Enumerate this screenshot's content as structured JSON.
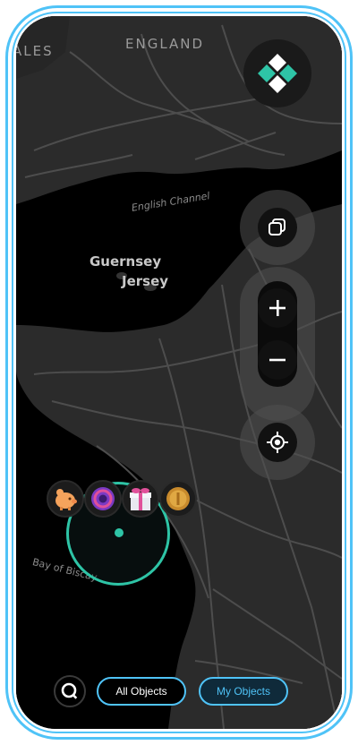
{
  "map": {
    "labels": {
      "wales": "ALES",
      "england": "ENGLAND",
      "channel": "English Channel",
      "guernsey": "Guernsey",
      "jersey": "Jersey",
      "biscay": "Bay of Biscay"
    }
  },
  "controls": {
    "zoom_in_symbol": "+",
    "zoom_out_symbol": "−",
    "icons": [
      "app-logo-icon",
      "layers-icon",
      "plus-icon",
      "minus-icon",
      "locate-icon",
      "search-icon"
    ]
  },
  "objects": [
    {
      "name": "piggy-bank",
      "icon": "piggy-bank-icon"
    },
    {
      "name": "orb",
      "icon": "portal-orb-icon"
    },
    {
      "name": "gift",
      "icon": "gift-box-icon"
    },
    {
      "name": "coin",
      "icon": "gold-coin-icon"
    }
  ],
  "bottom_bar": {
    "all_objects_label": "All Objects",
    "my_objects_label": "My Objects"
  },
  "colors": {
    "frame": "#4fc3f7",
    "accent_teal": "#2ec4a6",
    "map_bg": "#000000",
    "land": "#2b2b2b",
    "roads": "#4a4a4a"
  }
}
